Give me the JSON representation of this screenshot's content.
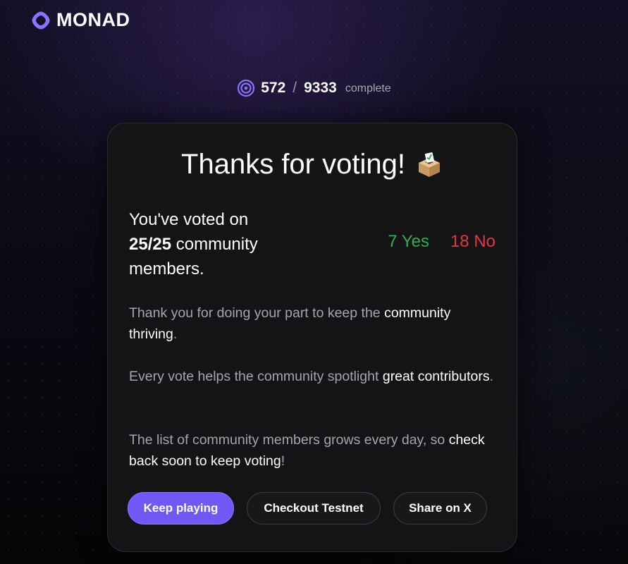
{
  "brand": {
    "name": "MONAD",
    "accent": "#7058f5"
  },
  "progress": {
    "current": "572",
    "separator": "/",
    "total": "9333",
    "label": "complete"
  },
  "card": {
    "title": "Thanks for voting!",
    "summary": {
      "prefix": "You've voted on",
      "count": "25/25",
      "suffix": "community members."
    },
    "tally": {
      "yes": "7 Yes",
      "no": "18 No",
      "yes_color": "#2bb24c",
      "no_color": "#e0393e"
    },
    "paragraphs": [
      {
        "before": "Thank you for doing your part to keep the",
        "highlight": "community thriving",
        "after": "."
      },
      {
        "before": "Every vote helps the community spotlight",
        "highlight": "great contributors",
        "after": "."
      },
      {
        "before": "The list of community members grows every day, so",
        "highlight": "check back soon to keep voting",
        "after": "!"
      }
    ],
    "buttons": {
      "keep_playing": "Keep playing",
      "checkout_testnet": "Checkout Testnet",
      "share_x": "Share on X"
    }
  }
}
